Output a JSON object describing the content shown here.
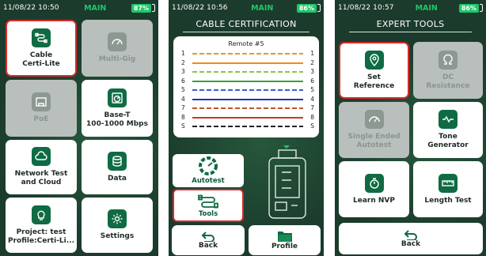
{
  "screen1": {
    "time": "11/08/22 10:50",
    "mode": "MAIN",
    "battery": "87%",
    "tiles": [
      {
        "label": "Cable\nCerti-Lite",
        "icon": "cable-icon",
        "selected": true,
        "disabled": false
      },
      {
        "label": "Multi-Gig",
        "icon": "speedometer-icon",
        "selected": false,
        "disabled": true
      },
      {
        "label": "PoE",
        "icon": "ethernet-port-icon",
        "selected": false,
        "disabled": true
      },
      {
        "label": "Base-T\n100-1000 Mbps",
        "icon": "gauge-icon",
        "selected": false,
        "disabled": false
      },
      {
        "label": "Network Test\nand Cloud",
        "icon": "cloud-icon",
        "selected": false,
        "disabled": false
      },
      {
        "label": "Data",
        "icon": "database-icon",
        "selected": false,
        "disabled": false
      },
      {
        "label": "Project: test\nProfile:Certi-Li...",
        "icon": "lightbulb-icon",
        "selected": false,
        "disabled": false
      },
      {
        "label": "Settings",
        "icon": "gear-icon",
        "selected": false,
        "disabled": false
      }
    ]
  },
  "screen2": {
    "time": "11/08/22 10:56",
    "mode": "MAIN",
    "battery": "86%",
    "title": "CABLE CERTIFICATION",
    "remote": "Remote #5",
    "wires": [
      {
        "left": "1",
        "right": "1",
        "color": "#e39b2c",
        "dashed": true
      },
      {
        "left": "2",
        "right": "2",
        "color": "#f28a1a",
        "dashed": false
      },
      {
        "left": "3",
        "right": "3",
        "color": "#7fc94b",
        "dashed": true
      },
      {
        "left": "6",
        "right": "6",
        "color": "#35a23a",
        "dashed": false
      },
      {
        "left": "5",
        "right": "5",
        "color": "#3b5ccc",
        "dashed": true
      },
      {
        "left": "4",
        "right": "4",
        "color": "#2430c2",
        "dashed": false
      },
      {
        "left": "7",
        "right": "7",
        "color": "#b9572a",
        "dashed": true
      },
      {
        "left": "8",
        "right": "8",
        "color": "#cc3a1e",
        "dashed": false
      },
      {
        "left": "S",
        "right": "S",
        "color": "#222222",
        "dashed": true
      }
    ],
    "autotest_label": "Autotest",
    "tools_label": "Tools",
    "back_label": "Back",
    "profile_label": "Profile"
  },
  "screen3": {
    "time": "11/08/22 10:57",
    "mode": "MAIN",
    "battery": "86%",
    "title": "EXPERT TOOLS",
    "tiles": [
      {
        "label": "Set\nReference",
        "icon": "location-pin-icon",
        "selected": true,
        "disabled": false
      },
      {
        "label": "DC\nResistance",
        "icon": "omega-icon",
        "selected": false,
        "disabled": true
      },
      {
        "label": "Single Ended\nAutotest",
        "icon": "gauge-icon",
        "selected": false,
        "disabled": true
      },
      {
        "label": "Tone\nGenerator",
        "icon": "waveform-icon",
        "selected": false,
        "disabled": false
      },
      {
        "label": "Learn NVP",
        "icon": "timer-icon",
        "selected": false,
        "disabled": false
      },
      {
        "label": "Length Test",
        "icon": "ruler-icon",
        "selected": false,
        "disabled": false
      }
    ],
    "back_label": "Back"
  },
  "colors": {
    "background": "#1b3b2c",
    "accent": "#1fc76a",
    "icon_green": "#0f6b43",
    "select_red": "#d82a2a"
  }
}
